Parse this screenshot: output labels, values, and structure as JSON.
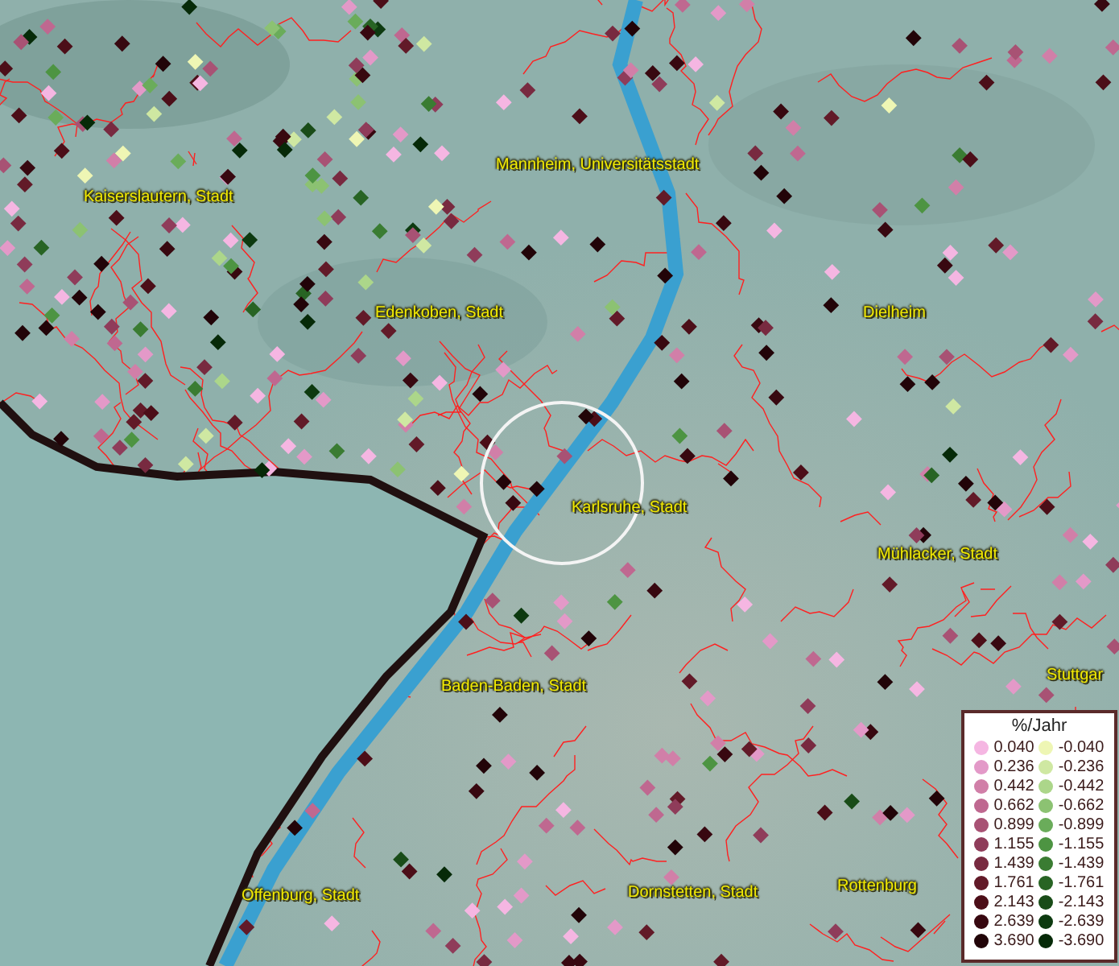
{
  "map": {
    "places": [
      {
        "name": "Mannheim, Universitätsstadt"
      },
      {
        "name": "Kaiserslautern, Stadt"
      },
      {
        "name": "Edenkoben, Stadt"
      },
      {
        "name": "Dielheim"
      },
      {
        "name": "Karlsruhe, Stadt"
      },
      {
        "name": "Mühlacker, Stadt"
      },
      {
        "name": "Stuttgar"
      },
      {
        "name": "Baden-Baden, Stadt"
      },
      {
        "name": "Offenburg, Stadt"
      },
      {
        "name": "Dornstetten, Stadt"
      },
      {
        "name": "Rottenburg"
      }
    ]
  },
  "legend": {
    "title": "%/Jahr",
    "rows": [
      {
        "positive": {
          "value": "0.040",
          "color": "#f5b6e2"
        },
        "negative": {
          "value": "-0.040",
          "color": "#eef6b4"
        }
      },
      {
        "positive": {
          "value": "0.236",
          "color": "#e399c8"
        },
        "negative": {
          "value": "-0.236",
          "color": "#cfe8a2"
        }
      },
      {
        "positive": {
          "value": "0.442",
          "color": "#d17fa8"
        },
        "negative": {
          "value": "-0.442",
          "color": "#acd68a"
        }
      },
      {
        "positive": {
          "value": "0.662",
          "color": "#bf6890"
        },
        "negative": {
          "value": "-0.662",
          "color": "#8cc272"
        }
      },
      {
        "positive": {
          "value": "0.899",
          "color": "#a85274"
        },
        "negative": {
          "value": "-0.899",
          "color": "#6aac5a"
        }
      },
      {
        "positive": {
          "value": "1.155",
          "color": "#8f3c5a"
        },
        "negative": {
          "value": "-1.155",
          "color": "#4d9442"
        }
      },
      {
        "positive": {
          "value": "1.439",
          "color": "#782a40"
        },
        "negative": {
          "value": "-1.439",
          "color": "#3a7c32"
        }
      },
      {
        "positive": {
          "value": "1.761",
          "color": "#621a28"
        },
        "negative": {
          "value": "-1.761",
          "color": "#286424"
        }
      },
      {
        "positive": {
          "value": "2.143",
          "color": "#4c0e18"
        },
        "negative": {
          "value": "-2.143",
          "color": "#194c18"
        }
      },
      {
        "positive": {
          "value": "2.639",
          "color": "#380810"
        },
        "negative": {
          "value": "-2.639",
          "color": "#0d3a10"
        }
      },
      {
        "positive": {
          "value": "3.690",
          "color": "#220408"
        },
        "negative": {
          "value": "-3.690",
          "color": "#062a08"
        }
      }
    ]
  }
}
